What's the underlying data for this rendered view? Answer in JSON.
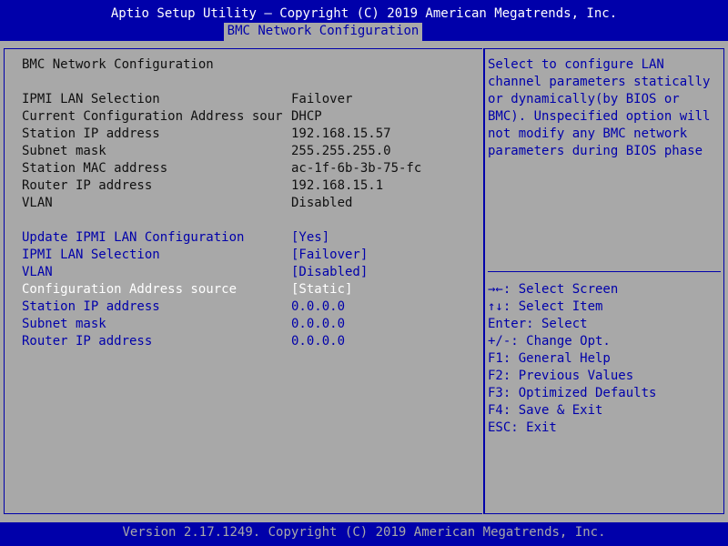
{
  "header": {
    "title": "Aptio Setup Utility – Copyright (C) 2019 American Megatrends, Inc.",
    "active_tab": "BMC Network Configuration"
  },
  "main": {
    "section_title": "BMC Network Configuration",
    "info_rows": [
      {
        "label": "IPMI LAN Selection",
        "value": "Failover"
      },
      {
        "label": "Current Configuration Address sour",
        "value": "DHCP"
      },
      {
        "label": "Station IP address",
        "value": "192.168.15.57"
      },
      {
        "label": "Subnet mask",
        "value": "255.255.255.0"
      },
      {
        "label": "Station MAC address",
        "value": "ac-1f-6b-3b-75-fc"
      },
      {
        "label": "Router IP address",
        "value": "192.168.15.1"
      },
      {
        "label": "VLAN",
        "value": "Disabled"
      }
    ],
    "settings": [
      {
        "label": "Update IPMI LAN Configuration",
        "value": "[Yes]"
      },
      {
        "label": "IPMI LAN Selection",
        "value": "[Failover]"
      },
      {
        "label": "VLAN",
        "value": "[Disabled]"
      },
      {
        "label": "Configuration Address source",
        "value": "[Static]",
        "selected": true
      },
      {
        "label": "Station IP address",
        "value": "0.0.0.0"
      },
      {
        "label": "Subnet mask",
        "value": "0.0.0.0"
      },
      {
        "label": "Router IP address",
        "value": "0.0.0.0"
      }
    ]
  },
  "help": {
    "description_lines": [
      "Select to configure LAN",
      "channel parameters statically",
      "or dynamically(by BIOS or",
      "BMC). Unspecified option will",
      "not modify any BMC network",
      "parameters during BIOS phase"
    ],
    "keys": [
      "→←: Select Screen",
      "↑↓: Select Item",
      "Enter: Select",
      "+/-: Change Opt.",
      "F1: General Help",
      "F2: Previous Values",
      "F3: Optimized Defaults",
      "F4: Save & Exit",
      "ESC: Exit"
    ]
  },
  "footer": {
    "text": "Version 2.17.1249. Copyright (C) 2019 American Megatrends, Inc."
  },
  "colors": {
    "background": "#a8a8a8",
    "bar_blue": "#0000aa",
    "selected_text": "#ffffff"
  }
}
